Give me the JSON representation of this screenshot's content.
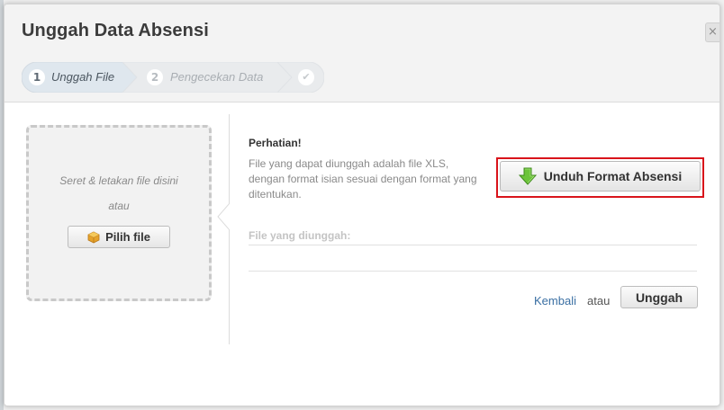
{
  "dialog": {
    "title": "Unggah Data Absensi",
    "close_label": "×"
  },
  "steps": [
    {
      "number": "1",
      "label": "Unggah File",
      "state": "active"
    },
    {
      "number": "2",
      "label": "Pengecekan Data",
      "state": "inactive"
    },
    {
      "number": "",
      "label": "",
      "state": "inactive",
      "icon": "check-icon"
    }
  ],
  "dropzone": {
    "hint": "Seret & letakan file disini",
    "or": "atau",
    "pick_label": "Pilih file",
    "pick_icon": "package-icon"
  },
  "notice": {
    "title": "Perhatian!",
    "body": "File yang dapat diunggah adalah file XLS, dengan format isian sesuai dengan format yang ditentukan."
  },
  "download": {
    "label": "Unduh Format Absensi",
    "icon": "arrow-down-icon",
    "highlight_color": "#d9141b"
  },
  "uploaded": {
    "label": "File yang diunggah:"
  },
  "footer": {
    "back_label": "Kembali",
    "or": "atau",
    "upload_label": "Unggah"
  },
  "colors": {
    "link": "#3a6fa3",
    "step_active_bg": "#dfe7ee",
    "step_inactive_bg": "#e9ebed"
  }
}
